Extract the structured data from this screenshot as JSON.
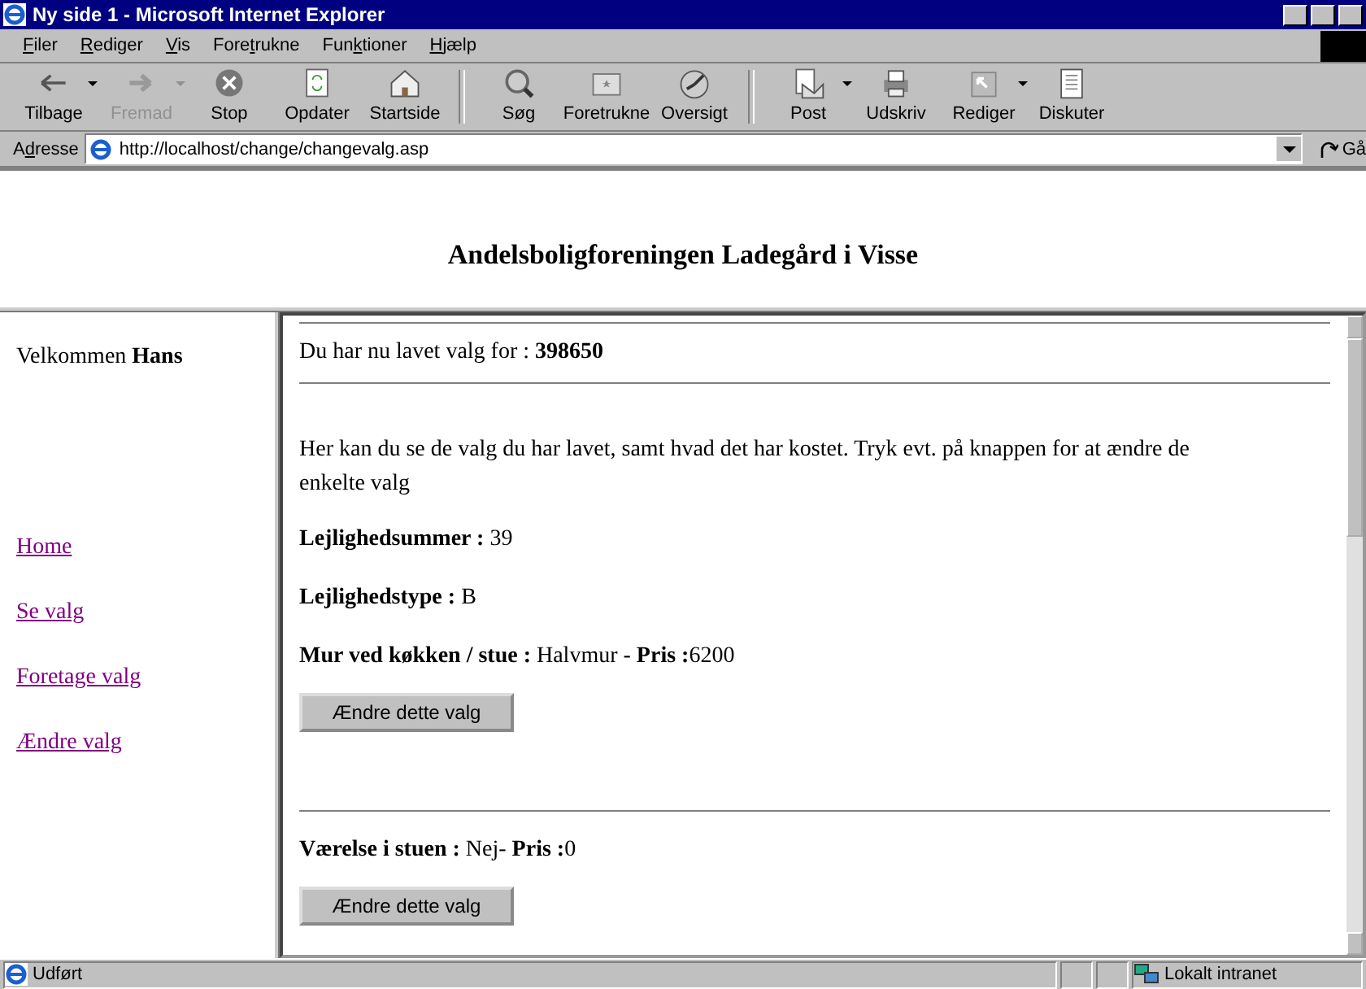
{
  "window": {
    "title": "Ny side 1 - Microsoft Internet Explorer"
  },
  "menu": [
    {
      "key": "F",
      "after": "iler"
    },
    {
      "key": "R",
      "after": "ediger"
    },
    {
      "key": "V",
      "after": "is"
    },
    {
      "before": "Fore",
      "key": "t",
      "after": "rukne"
    },
    {
      "before": "Fun",
      "key": "k",
      "after": "tioner"
    },
    {
      "key": "H",
      "after": "jælp"
    }
  ],
  "toolbar": [
    {
      "label": "Tilbage",
      "disabled": false,
      "dropdown": true
    },
    {
      "label": "Fremad",
      "disabled": true,
      "dropdown": true
    },
    {
      "label": "Stop",
      "disabled": false,
      "dropdown": false
    },
    {
      "label": "Opdater",
      "disabled": false,
      "dropdown": false
    },
    {
      "label": "Startside",
      "disabled": false,
      "dropdown": false
    },
    {
      "label": "Søg",
      "disabled": false,
      "dropdown": false
    },
    {
      "label": "Foretrukne",
      "disabled": false,
      "dropdown": false
    },
    {
      "label": "Oversigt",
      "disabled": false,
      "dropdown": false
    },
    {
      "label": "Post",
      "disabled": false,
      "dropdown": true
    },
    {
      "label": "Udskriv",
      "disabled": false,
      "dropdown": false
    },
    {
      "label": "Rediger",
      "disabled": false,
      "dropdown": true
    },
    {
      "label": "Diskuter",
      "disabled": false,
      "dropdown": false
    }
  ],
  "address": {
    "label_before": "A",
    "label_key": "d",
    "label_after": "resse",
    "value": "http://localhost/change/changevalg.asp",
    "go": "Gå"
  },
  "page": {
    "heading": "Andelsboligforeningen Ladegård i Visse",
    "sidebar": {
      "welcome": "Velkommen **Hans**",
      "links": [
        "Home",
        "Se valg",
        "Foretage valg",
        "Ændre valg"
      ]
    },
    "content": {
      "intro": "Du har nu lavet valg for : **398650**",
      "text": "Her kan du se de valg du har lavet, samt hvad det har kostet. Tryk evt. på knappen for at ændre de enkelte valg",
      "info": [
        "**Lejlighedsummer :** 39",
        "**Lejlighedstype :** B"
      ],
      "choices": [
        {
          "text": "**Mur ved køkken / stue :** Halvmur - **Pris :**6200",
          "button": "Ændre dette valg"
        },
        {
          "text": "**Værelse i stuen :** Nej- **Pris :**0",
          "button": "Ændre dette valg"
        }
      ]
    }
  },
  "status_bar": {
    "text": "Udført",
    "zone": "Lokalt intranet"
  }
}
